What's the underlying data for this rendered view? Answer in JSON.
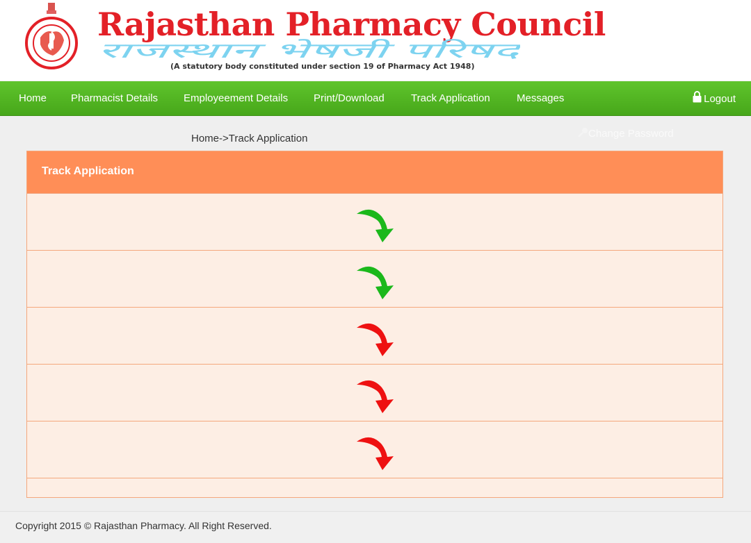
{
  "header": {
    "title_en": "Rajasthan Pharmacy Council",
    "title_hi": "राजस्थान भेषजी परिषद",
    "subtitle": "(A statutory body constituted under section 19 of Pharmacy Act 1948)",
    "brand_color": "#e32027",
    "hindi_color": "#7dd3f0"
  },
  "nav": {
    "items": [
      "Home",
      "Pharmacist Details",
      "Employeement Details",
      "Print/Download",
      "Track Application",
      "Messages"
    ],
    "logout": "Logout",
    "color": "#4cb020"
  },
  "breadcrumb": "Home->Track Application",
  "change_password": "Change Password",
  "panel": {
    "title": "Track Application",
    "header_color": "#ff8e57",
    "row_bg": "#fdeee4",
    "steps": [
      {
        "status": "completed",
        "icon": "green-arrow-icon",
        "color": "#1bb81b"
      },
      {
        "status": "completed",
        "icon": "green-arrow-icon",
        "color": "#1bb81b"
      },
      {
        "status": "pending",
        "icon": "red-arrow-icon",
        "color": "#ee1111"
      },
      {
        "status": "pending",
        "icon": "red-arrow-icon",
        "color": "#ee1111"
      },
      {
        "status": "pending",
        "icon": "red-arrow-icon",
        "color": "#ee1111"
      }
    ]
  },
  "footer": {
    "copyright": "Copyright 2015 © Rajasthan Pharmacy. All Right Reserved."
  }
}
